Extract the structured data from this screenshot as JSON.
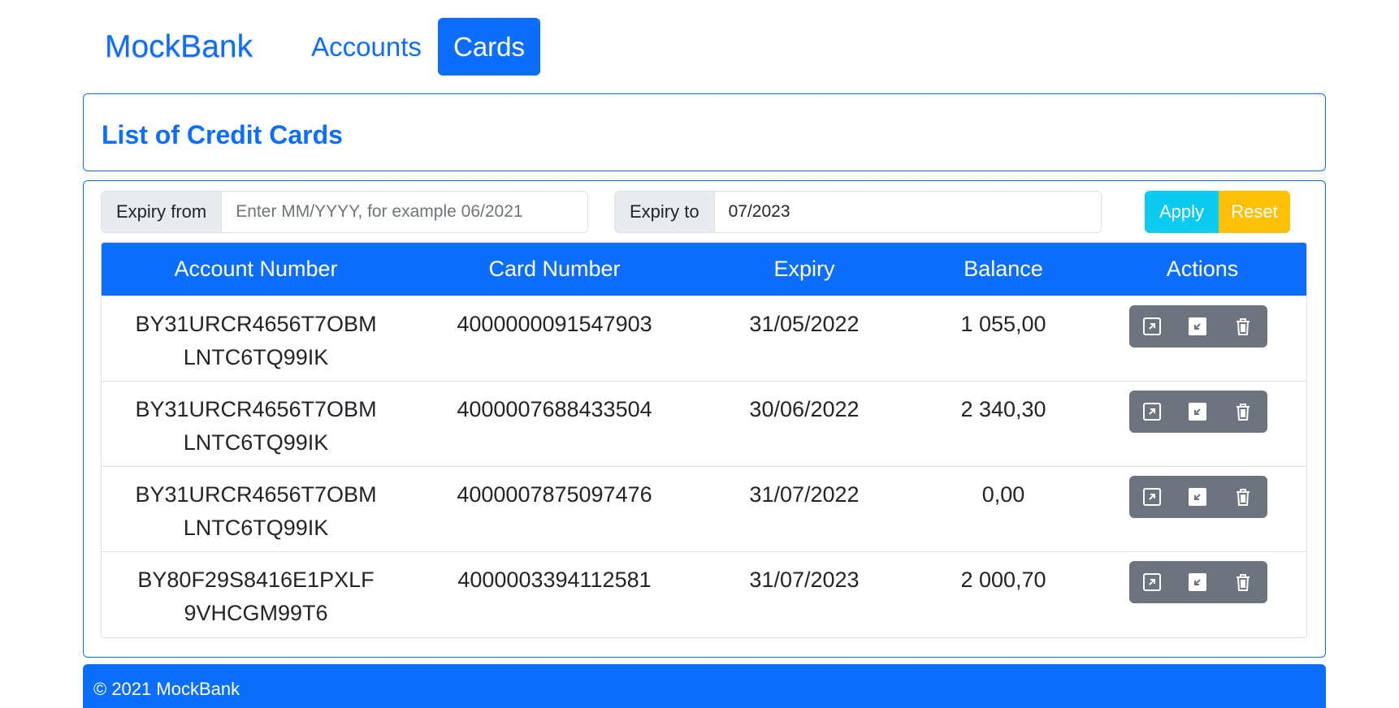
{
  "navbar": {
    "brand": "MockBank",
    "links": [
      {
        "label": "Accounts",
        "active": false
      },
      {
        "label": "Cards",
        "active": true
      }
    ]
  },
  "page_title": "List of Credit Cards",
  "filters": {
    "expiry_from_label": "Expiry from",
    "expiry_from_value": "",
    "expiry_from_placeholder": "Enter MM/YYYY, for example 06/2021",
    "expiry_to_label": "Expiry to",
    "expiry_to_value": "07/2023",
    "apply_label": "Apply",
    "reset_label": "Reset"
  },
  "table": {
    "columns": [
      "Account Number",
      "Card Number",
      "Expiry",
      "Balance",
      "Actions"
    ],
    "rows": [
      {
        "account": "BY31URCR4656T7OBMLNTC6TQ99IK",
        "card": "4000000091547903",
        "expiry": "31/05/2022",
        "balance": "1 055,00"
      },
      {
        "account": "BY31URCR4656T7OBMLNTC6TQ99IK",
        "card": "4000007688433504",
        "expiry": "30/06/2022",
        "balance": "2 340,30"
      },
      {
        "account": "BY31URCR4656T7OBMLNTC6TQ99IK",
        "card": "4000007875097476",
        "expiry": "31/07/2022",
        "balance": "0,00"
      },
      {
        "account": "BY80F29S8416E1PXLF9VHCGM99T6",
        "card": "4000003394112581",
        "expiry": "31/07/2023",
        "balance": "2 000,70"
      }
    ],
    "action_icons": [
      "open-external-icon",
      "minimize-icon",
      "trash-icon"
    ]
  },
  "footer": {
    "text": "© 2021 MockBank"
  },
  "colors": {
    "primary": "#0d6efd",
    "info": "#0dcaf0",
    "warning": "#ffc107",
    "secondary": "#6c757d"
  }
}
